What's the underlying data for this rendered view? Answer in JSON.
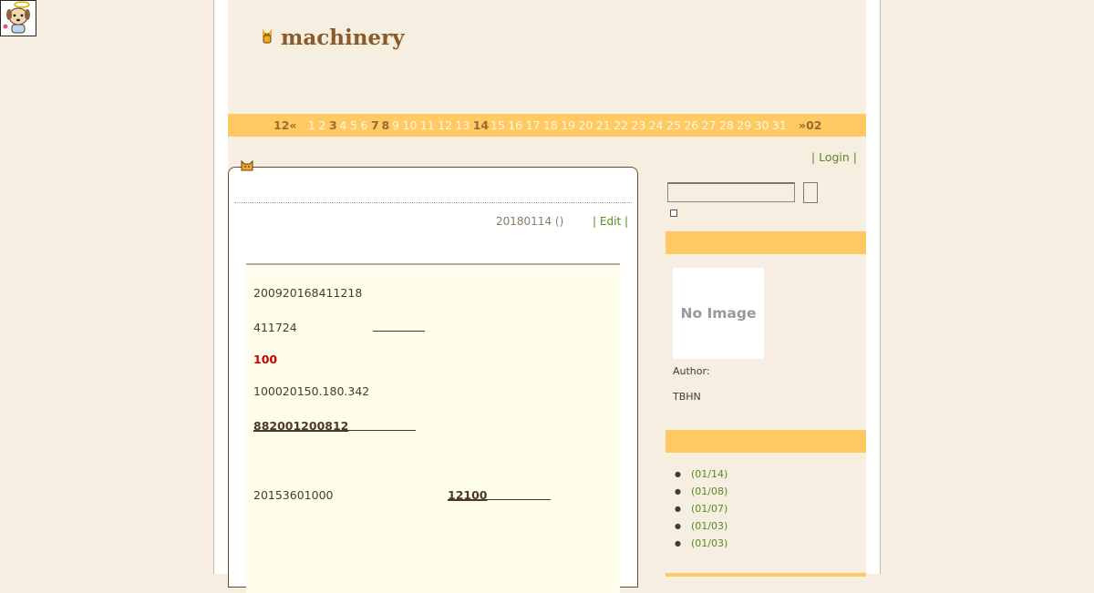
{
  "site": {
    "title": "machinery"
  },
  "calendar": {
    "prev": "12«",
    "next": "»02",
    "days": [
      {
        "d": "1",
        "link": false
      },
      {
        "d": "2",
        "link": false
      },
      {
        "d": "3",
        "link": true
      },
      {
        "d": "4",
        "link": false
      },
      {
        "d": "5",
        "link": false
      },
      {
        "d": "6",
        "link": false
      },
      {
        "d": "7",
        "link": true
      },
      {
        "d": "8",
        "link": true
      },
      {
        "d": "9",
        "link": false
      },
      {
        "d": "10",
        "link": false
      },
      {
        "d": "11",
        "link": false
      },
      {
        "d": "12",
        "link": false
      },
      {
        "d": "13",
        "link": false
      },
      {
        "d": "14",
        "link": true
      },
      {
        "d": "15",
        "link": false
      },
      {
        "d": "16",
        "link": false
      },
      {
        "d": "17",
        "link": false
      },
      {
        "d": "18",
        "link": false
      },
      {
        "d": "19",
        "link": false
      },
      {
        "d": "20",
        "link": false
      },
      {
        "d": "21",
        "link": false
      },
      {
        "d": "22",
        "link": false
      },
      {
        "d": "23",
        "link": false
      },
      {
        "d": "24",
        "link": false
      },
      {
        "d": "25",
        "link": false
      },
      {
        "d": "26",
        "link": false
      },
      {
        "d": "27",
        "link": false
      },
      {
        "d": "28",
        "link": false
      },
      {
        "d": "29",
        "link": false
      },
      {
        "d": "30",
        "link": false
      },
      {
        "d": "31",
        "link": false
      }
    ]
  },
  "nav": {
    "login": "| Login |"
  },
  "post": {
    "meta": "20180114 ()",
    "edit": "| Edit |",
    "lines": {
      "l1": "200920168411218",
      "l2": "411724",
      "l3": "100",
      "l4": "100020150.180.342",
      "l5": "882001200812",
      "l6a": "20153601000",
      "l6b": "12100"
    }
  },
  "sidebar": {
    "profile": {
      "image_text": "No Image",
      "author_label": "Author:",
      "author_name": "TBHN"
    },
    "recent": [
      "(01/14)",
      "(01/08)",
      "(01/07)",
      "(01/03)",
      "(01/03)"
    ]
  },
  "colors": {
    "accent": "#ffca63",
    "background": "#f5eee1",
    "title": "#8b5a2b",
    "link": "#5a8a1f",
    "highlight": "#cc0000"
  }
}
